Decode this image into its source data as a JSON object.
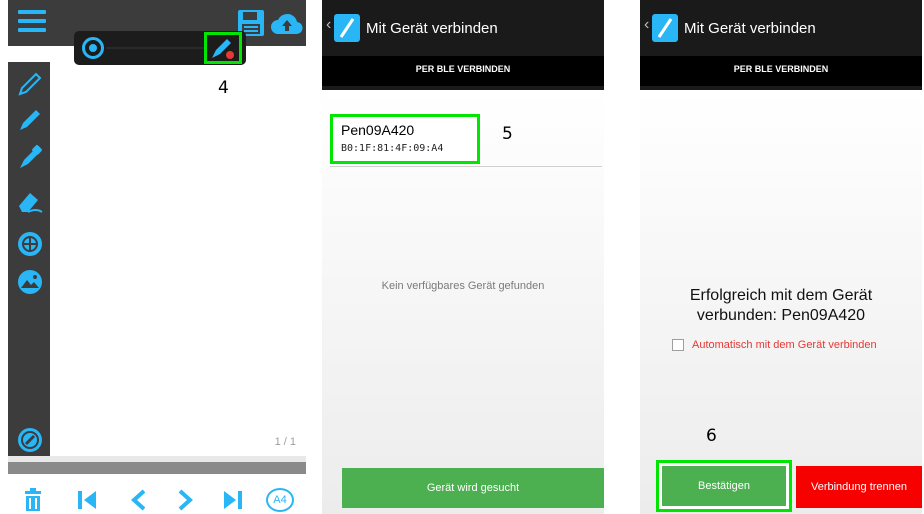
{
  "steps": {
    "step4": "4",
    "step5": "5",
    "step6": "6"
  },
  "drawing_app": {
    "page_indicator": "1 / 1",
    "paper_size": "A4",
    "accent_color": "#29b6f6",
    "icons": {
      "menu": "menu-icon",
      "save": "save-icon",
      "cloud": "cloud-upload-icon",
      "tools": [
        "pencil-icon",
        "pen-icon",
        "dropper-pen-icon",
        "eraser-icon",
        "target-icon",
        "image-icon",
        "connect-icon"
      ],
      "bottom": [
        "trash-icon",
        "first-page-icon",
        "prev-page-icon",
        "next-page-icon",
        "last-page-icon",
        "a4-icon"
      ]
    }
  },
  "scan_screen": {
    "title": "Mit Gerät verbinden",
    "tab": "PER BLE VERBINDEN",
    "device_name": "Pen09A420",
    "device_address": "B0:1F:81:4F:09:A4",
    "empty_message": "Kein verfügbares Gerät gefunden",
    "search_button": "Gerät wird gesucht"
  },
  "connected_screen": {
    "title": "Mit Gerät verbinden",
    "tab": "PER BLE VERBINDEN",
    "success_line1": "Erfolgreich mit dem Gerät",
    "success_line2": "verbunden: Pen09A420",
    "auto_connect_label": "Automatisch mit dem Gerät verbinden",
    "auto_connect_checked": false,
    "confirm_button": "Bestätigen",
    "disconnect_button": "Verbindung trennen"
  },
  "colors": {
    "highlight": "#00e600",
    "green_button": "#4caf50",
    "red_button": "#f70000",
    "header": "#1a1a1a"
  }
}
